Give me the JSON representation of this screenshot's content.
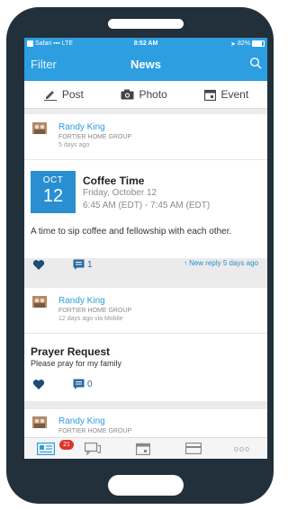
{
  "status_bar": {
    "carrier": "Safari",
    "network": "LTE",
    "time": "8:52 AM",
    "battery": "82%"
  },
  "nav": {
    "filter_label": "Filter",
    "title": "News",
    "search_icon": "search-icon"
  },
  "composer": {
    "post_label": "Post",
    "photo_label": "Photo",
    "event_label": "Event"
  },
  "feed": [
    {
      "author": "Randy King",
      "group": "FORTIER HOME GROUP",
      "time": "5 days ago",
      "event": {
        "month": "OCT",
        "day": "12",
        "title": "Coffee Time",
        "date": "Friday, October 12",
        "time": "6:45 AM (EDT) - 7:45 AM (EDT)"
      },
      "description": "A time to sip coffee and fellowship with each other.",
      "comments": "1",
      "reply": "New reply 5 days ago"
    },
    {
      "author": "Randy King",
      "group": "FORTIER HOME GROUP",
      "time": "12 days ago via Mobile",
      "title": "Prayer Request",
      "body": "Please pray for my family",
      "comments": "0"
    },
    {
      "author": "Randy King",
      "group": "FORTIER HOME GROUP"
    }
  ],
  "tab_bar": {
    "news_badge": "21",
    "more_label": "ooo"
  },
  "colors": {
    "accent": "#2d9ee0",
    "dark_blue": "#2a6aa0",
    "badge": "#d9382b",
    "phone": "#22303b"
  }
}
